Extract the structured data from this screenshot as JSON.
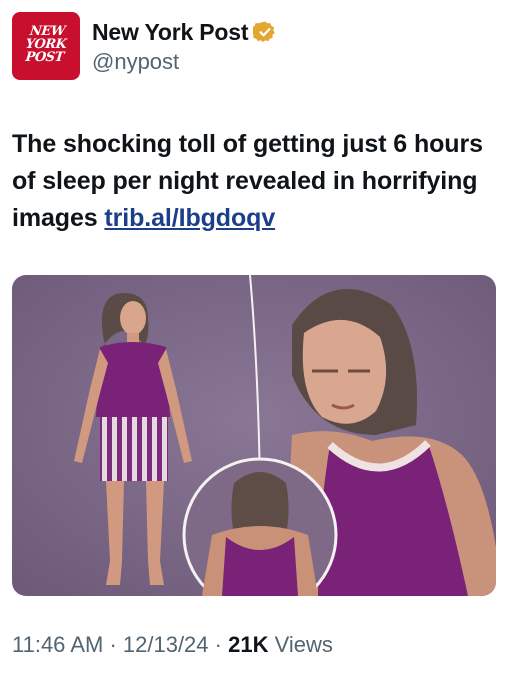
{
  "account": {
    "logo_text": "NEW\nYORK\nPOST",
    "name": "New York Post",
    "handle": "@nypost",
    "verified_icon": "gold-check-badge"
  },
  "tweet": {
    "text": "The shocking toll of getting just 6 hours of sleep per night revealed in horrifying images ",
    "link": "trib.al/Ibgdoqv"
  },
  "media": {
    "description_icon": "image"
  },
  "meta": {
    "time": "11:46 AM",
    "sep1": " · ",
    "date": "12/13/24",
    "sep2": " · ",
    "views": "21K",
    "views_label": " Views"
  },
  "colors": {
    "brand_red": "#c8102e",
    "gold": "#e2a731",
    "link": "#1d3f8a",
    "muted": "#536471",
    "media_bg": "#7d6988"
  }
}
